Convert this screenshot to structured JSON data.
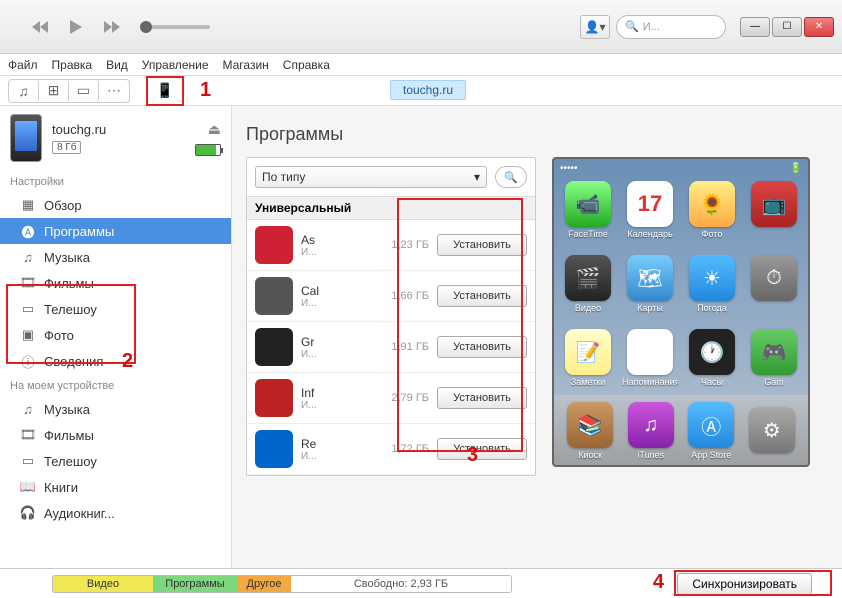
{
  "window": {
    "search_placeholder": "И...",
    "menu": [
      "Файл",
      "Правка",
      "Вид",
      "Управление",
      "Магазин",
      "Справка"
    ]
  },
  "breadcrumb": "touchg.ru",
  "annotations": {
    "a1": "1",
    "a2": "2",
    "a3": "3",
    "a4": "4"
  },
  "device": {
    "name": "touchg.ru",
    "capacity": "8 Гб"
  },
  "sidebar": {
    "settings_header": "Настройки",
    "settings": [
      {
        "label": "Обзор",
        "icon": "grid"
      },
      {
        "label": "Программы",
        "icon": "apps",
        "selected": true
      },
      {
        "label": "Музыка",
        "icon": "music"
      },
      {
        "label": "Фильмы",
        "icon": "film"
      },
      {
        "label": "Телешоу",
        "icon": "tv"
      },
      {
        "label": "Фото",
        "icon": "photo"
      },
      {
        "label": "Сведения",
        "icon": "info"
      }
    ],
    "on_device_header": "На моем устройстве",
    "on_device": [
      {
        "label": "Музыка",
        "icon": "music"
      },
      {
        "label": "Фильмы",
        "icon": "film"
      },
      {
        "label": "Телешоу",
        "icon": "tv"
      },
      {
        "label": "Книги",
        "icon": "book"
      },
      {
        "label": "Аудиокниг...",
        "icon": "audio"
      }
    ]
  },
  "content": {
    "title": "Программы",
    "sort_label": "По типу",
    "section_label": "Универсальный",
    "install_label": "Установить",
    "apps": [
      {
        "name": "As",
        "sub": "И...",
        "size": "1,23 ГБ",
        "color": "#c23"
      },
      {
        "name": "Cal",
        "sub": "И...",
        "size": "1,66 ГБ",
        "color": "#555"
      },
      {
        "name": "Gr",
        "sub": "И...",
        "size": "1,91 ГБ",
        "color": "#222"
      },
      {
        "name": "Inf",
        "sub": "И...",
        "size": "2,79 ГБ",
        "color": "#b22"
      },
      {
        "name": "Re",
        "sub": "И...",
        "size": "1,72 ГБ",
        "color": "#06c"
      }
    ]
  },
  "ios": {
    "carrier": "•••••",
    "time": "",
    "calendar_day": "17",
    "apps_row1": [
      {
        "label": "FaceTime",
        "bg": "linear-gradient(#8f8,#2a2)",
        "glyph": "📹"
      },
      {
        "label": "Календарь",
        "bg": "#fff",
        "glyph": ""
      },
      {
        "label": "Фото",
        "bg": "linear-gradient(#fe8,#fa4)",
        "glyph": "🌻"
      },
      {
        "label": "",
        "bg": "linear-gradient(#d44,#a22)",
        "glyph": "📺"
      }
    ],
    "apps_row2": [
      {
        "label": "Видео",
        "bg": "linear-gradient(#555,#222)",
        "glyph": "🎬"
      },
      {
        "label": "Карты",
        "bg": "linear-gradient(#7cf,#38c)",
        "glyph": "🗺"
      },
      {
        "label": "Погода",
        "bg": "linear-gradient(#5bf,#28d)",
        "glyph": "☀"
      },
      {
        "label": "",
        "bg": "linear-gradient(#999,#666)",
        "glyph": "⏱"
      }
    ],
    "apps_row3": [
      {
        "label": "Заметки",
        "bg": "linear-gradient(#ffc,#fe8)",
        "glyph": "📝"
      },
      {
        "label": "Напоминания",
        "bg": "#fff",
        "glyph": "═"
      },
      {
        "label": "Часы",
        "bg": "#222",
        "glyph": "🕐"
      },
      {
        "label": "Gam",
        "bg": "linear-gradient(#6c6,#393)",
        "glyph": "🎮"
      }
    ],
    "dock": [
      {
        "label": "Киоск",
        "bg": "linear-gradient(#c96,#963)",
        "glyph": "📚"
      },
      {
        "label": "iTunes",
        "bg": "linear-gradient(#c5d,#82a)",
        "glyph": "♫"
      },
      {
        "label": "App Store",
        "bg": "linear-gradient(#5bf,#28d)",
        "glyph": "Ⓐ"
      },
      {
        "label": "",
        "bg": "linear-gradient(#aaa,#777)",
        "glyph": "⚙"
      }
    ]
  },
  "storage": {
    "video": "Видео",
    "apps": "Программы",
    "other": "Другое",
    "free": "Свободно: 2,93 ГБ",
    "sync_label": "Синхронизировать"
  }
}
